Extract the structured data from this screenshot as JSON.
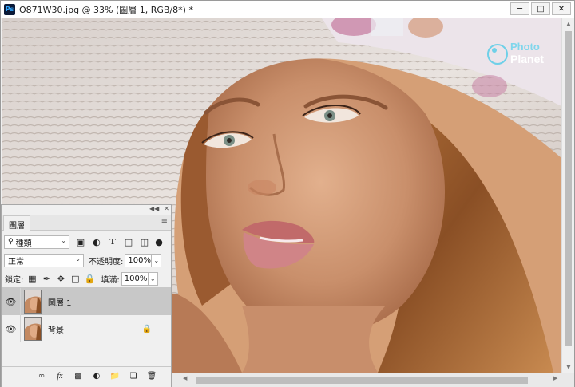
{
  "window": {
    "app_icon": "Ps",
    "title": "O871W30.jpg @ 33% (圖層 1, RGB/8*) *",
    "controls": [
      "minimize",
      "maximize",
      "close"
    ]
  },
  "canvas": {
    "watermark_line1": "Photo",
    "watermark_line2": "Planet"
  },
  "layers_panel": {
    "tab_label": "圖層",
    "filter_kind": "種類",
    "blend_mode": "正常",
    "opacity_label": "不透明度:",
    "opacity_value": "100%",
    "lock_label": "鎖定:",
    "fill_label": "填滿:",
    "fill_value": "100%",
    "layers": [
      {
        "name": "圖層 1",
        "selected": true,
        "locked": false
      },
      {
        "name": "背景",
        "selected": false,
        "locked": true
      }
    ],
    "footer_icons": [
      "link-icon",
      "fx-icon",
      "mask-icon",
      "adjustment-icon",
      "group-icon",
      "new-layer-icon",
      "trash-icon"
    ]
  },
  "colors": {
    "ps_blue": "#31a8ff",
    "selected_row": "#c8c8c8"
  }
}
